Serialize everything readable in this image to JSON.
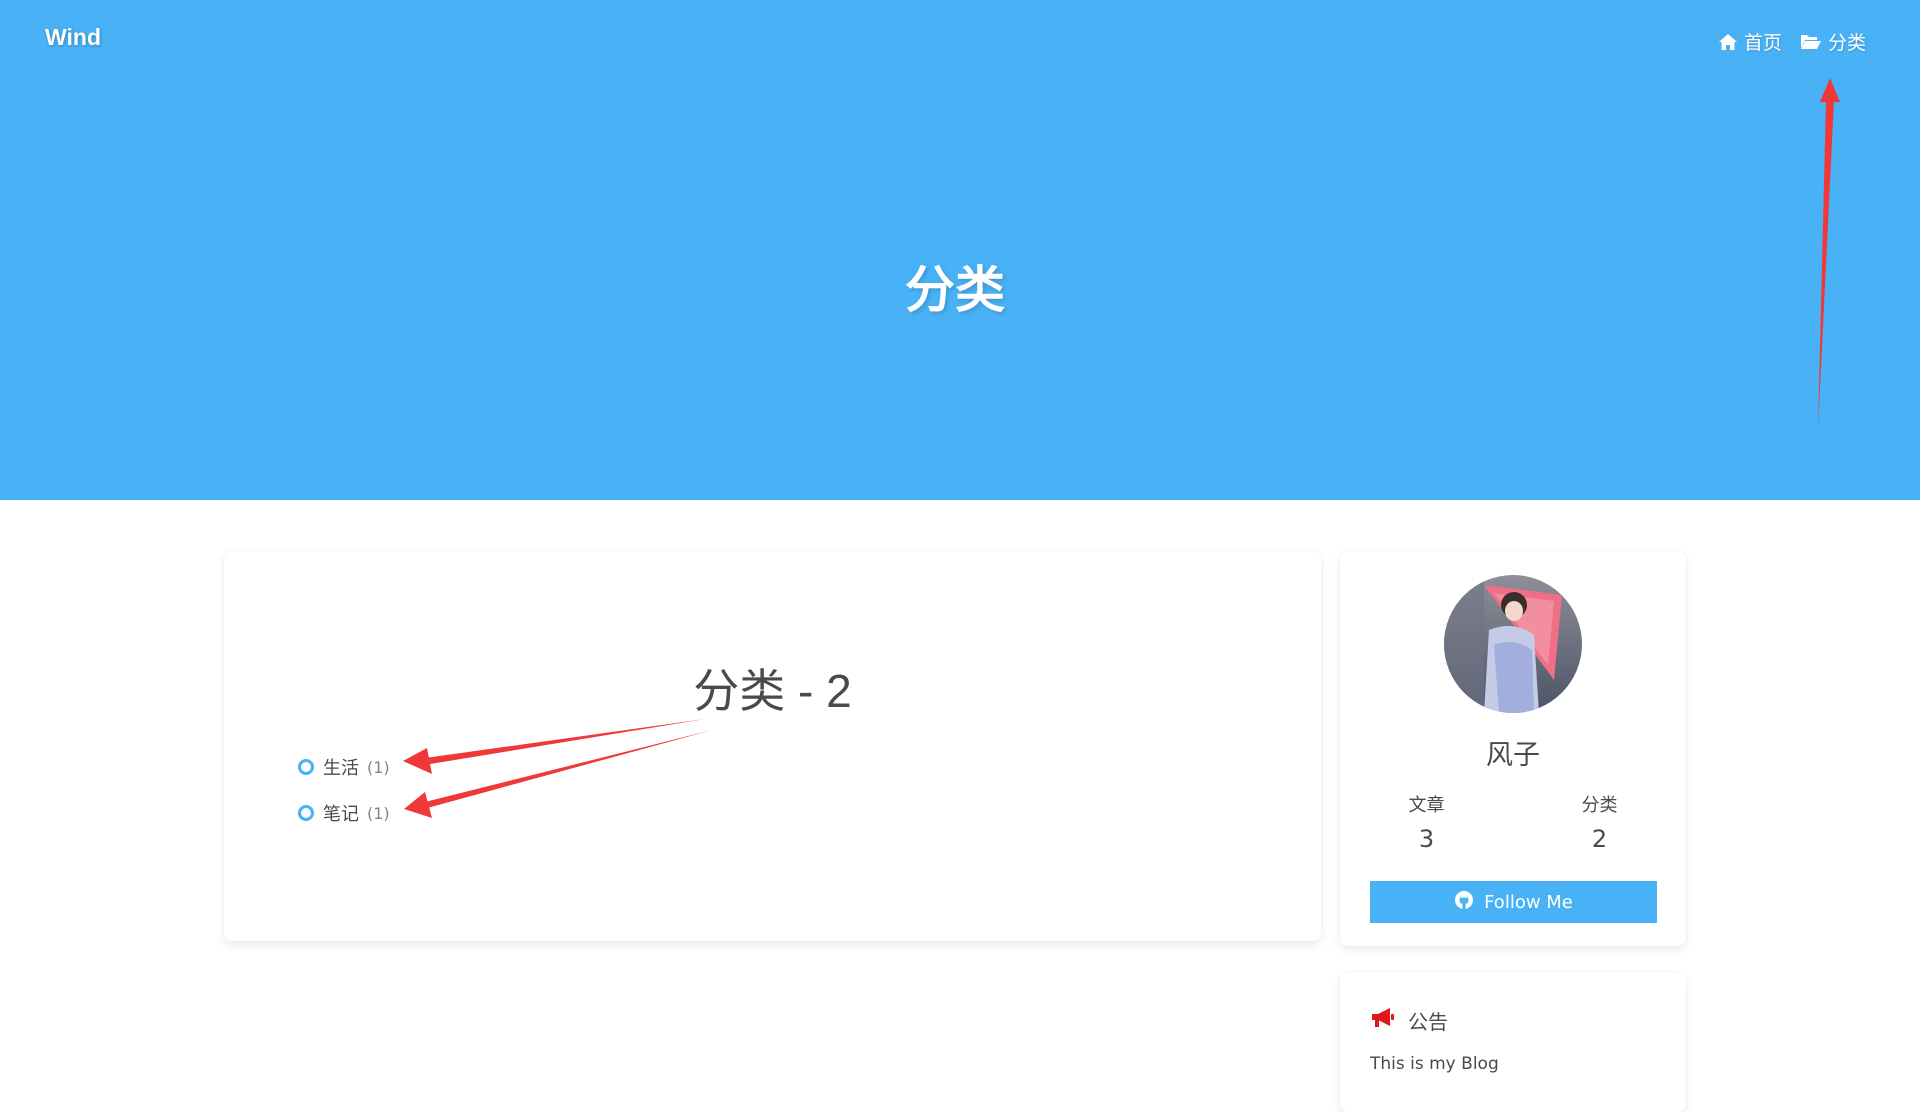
{
  "header": {
    "brand": "Wind",
    "nav": [
      {
        "label": "首页",
        "icon": "home-icon"
      },
      {
        "label": "分类",
        "icon": "folder-open-icon"
      }
    ],
    "hero_title": "分类"
  },
  "main": {
    "title": "分类 - 2",
    "categories": [
      {
        "name": "生活",
        "count": "(1)"
      },
      {
        "name": "笔记",
        "count": "(1)"
      }
    ]
  },
  "profile": {
    "name": "风子",
    "stats": [
      {
        "label": "文章",
        "value": "3"
      },
      {
        "label": "分类",
        "value": "2"
      }
    ],
    "follow_label": "Follow Me",
    "follow_icon": "github-icon"
  },
  "announcement": {
    "title": "公告",
    "icon": "bullhorn-icon",
    "text": "This is my Blog"
  },
  "colors": {
    "accent": "#49b1f5",
    "annotation_arrow": "#f03838",
    "announcement_icon": "#e0171e",
    "text": "#4c4948"
  }
}
